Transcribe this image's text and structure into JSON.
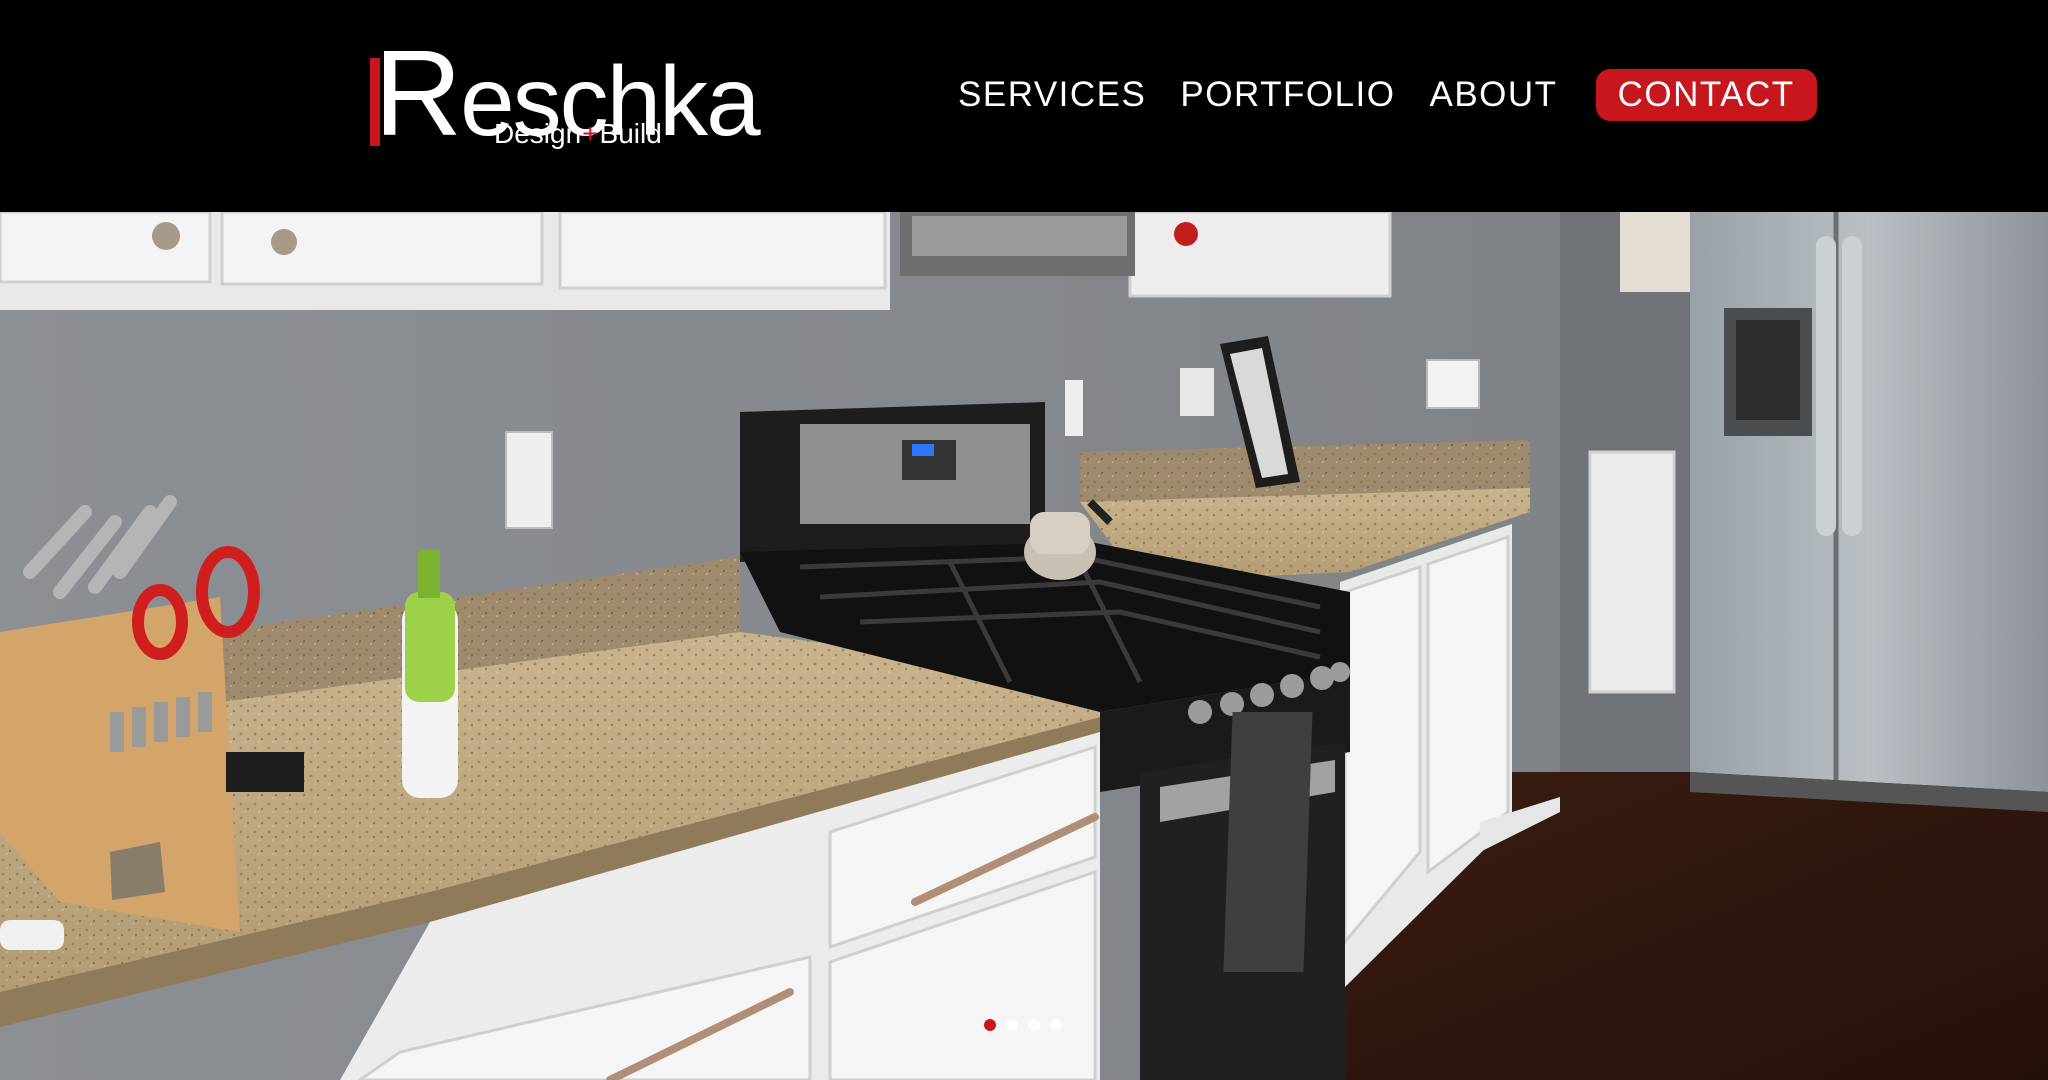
{
  "brand": {
    "name_first": "R",
    "name_rest": "eschka",
    "sub_a": "Design",
    "sub_plus": "+",
    "sub_b": "Build"
  },
  "nav": {
    "items": [
      {
        "label": "SERVICES"
      },
      {
        "label": "PORTFOLIO"
      },
      {
        "label": "ABOUT"
      }
    ],
    "contact_label": "CONTACT"
  },
  "slider": {
    "slide_count": 4,
    "active_index": 0
  },
  "colors": {
    "accent": "#c8161d",
    "header_bg": "#000000",
    "text": "#ffffff"
  }
}
